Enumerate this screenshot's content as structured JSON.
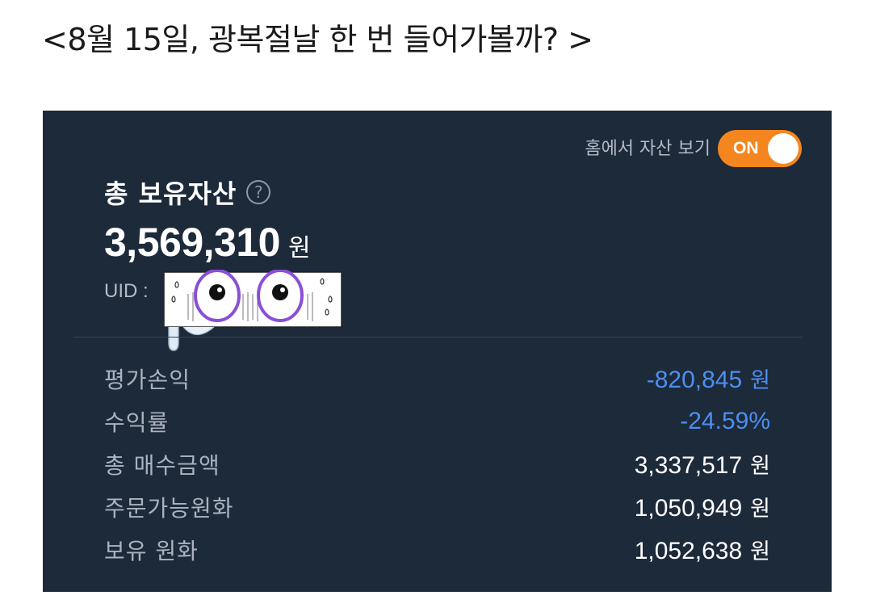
{
  "post": {
    "title": "<8월 15일, 광복절날 한 번 들어가볼까? >"
  },
  "panel": {
    "home_toggle_label": "홈에서 자산 보기",
    "toggle_state": "ON",
    "asset_title": "총 보유자산",
    "help_glyph": "?",
    "total_value": "3,569,310",
    "total_unit": "원",
    "uid_label": "UID :",
    "rows": [
      {
        "label": "평가손익",
        "value": "-820,845",
        "unit": "원",
        "negative": true
      },
      {
        "label": "수익률",
        "value": "-24.59%",
        "unit": "",
        "negative": true
      },
      {
        "label": "총 매수금액",
        "value": "3,337,517",
        "unit": "원",
        "negative": false
      },
      {
        "label": "주문가능원화",
        "value": "1,050,949",
        "unit": "원",
        "negative": false
      },
      {
        "label": "보유 원화",
        "value": "1,052,638",
        "unit": "원",
        "negative": false
      }
    ]
  },
  "colors": {
    "panel_bg": "#1d2a3a",
    "toggle_on": "#f5861f",
    "negative": "#4c8ff0",
    "sticker_ring": "#8a4fd6"
  },
  "icons": [
    "help-circle-icon",
    "sweating-eyes-sticker"
  ]
}
